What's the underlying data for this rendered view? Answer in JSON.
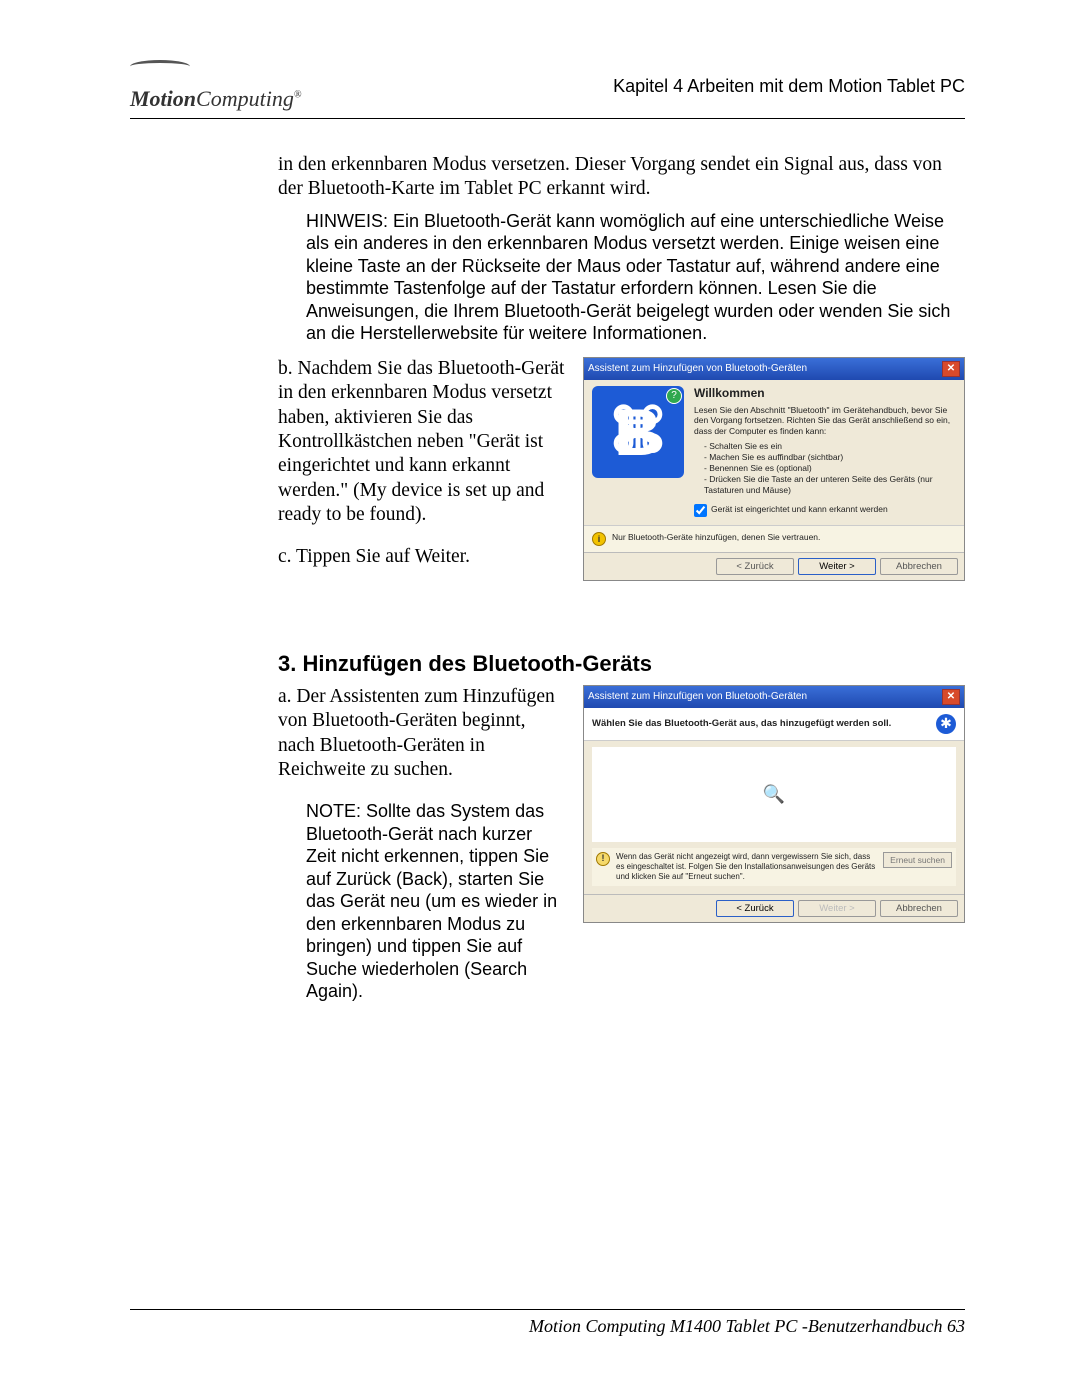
{
  "header": {
    "logo_bold": "Motion",
    "logo_light": "Computing",
    "chapter_strong": "Kapitel 4",
    "chapter_rest": " Arbeiten mit dem Motion Tablet PC"
  },
  "intro_para": "in den erkennbaren Modus versetzen. Dieser Vorgang sendet ein Signal aus, dass von der Bluetooth-Karte im Tablet PC erkannt wird.",
  "hinweis_label": "HINWEIS:",
  "hinweis_text": " Ein Bluetooth-Gerät kann womöglich auf eine unterschiedliche Weise als ein anderes in den erkennbaren Modus versetzt werden. Einige weisen eine kleine Taste an der Rückseite der Maus oder Tastatur auf, während andere eine bestimmte Tastenfolge auf der Tastatur erfordern können. Lesen Sie die Anweisungen, die Ihrem Bluetooth-Gerät beigelegt wurden oder wenden Sie sich an die Herstellerwebsite für weitere Informationen.",
  "step_b": "b. Nachdem Sie das Bluetooth-Gerät in den erkennbaren Modus versetzt haben, aktivieren Sie das Kontrollkästchen neben \"Gerät ist eingerichtet und kann erkannt werden.\" (My device is set up and ready to be found).",
  "step_c": "c. Tippen Sie auf Weiter.",
  "win1": {
    "title": "Assistent zum Hinzufügen von Bluetooth-Geräten",
    "welcome": "Willkommen",
    "desc": "Lesen Sie den Abschnitt \"Bluetooth\" im Gerätehandbuch, bevor Sie den Vorgang fortsetzen. Richten Sie das Gerät anschließend so ein, dass der Computer es finden kann:",
    "list": [
      "- Schalten Sie es ein",
      "- Machen Sie es auffindbar (sichtbar)",
      "- Benennen Sie es (optional)",
      "- Drücken Sie die Taste an der unteren Seite des Geräts (nur Tastaturen und Mäuse)"
    ],
    "checkbox": "Gerät ist eingerichtet und kann erkannt werden",
    "info": "Nur Bluetooth-Geräte hinzufügen, denen Sie vertrauen.",
    "btn_back": "< Zurück",
    "btn_next": "Weiter >",
    "btn_cancel": "Abbrechen"
  },
  "section3_heading": "3. Hinzufügen des Bluetooth-Geräts",
  "step_a": "a. Der Assistenten zum Hinzufügen von Bluetooth-Geräten beginnt, nach Bluetooth-Geräten in Reichweite zu suchen.",
  "note_label": "NOTE:",
  "note_text": " Sollte das System das Bluetooth-Gerät nach kurzer Zeit nicht erkennen, tippen Sie auf Zurück (Back), starten Sie das Gerät neu (um es wieder in den erkennbaren Modus zu bringen) und tippen Sie auf Suche wiederholen (Search Again).",
  "win2": {
    "title": "Assistent zum Hinzufügen von Bluetooth-Geräten",
    "head_text": "Wählen Sie das Bluetooth-Gerät aus, das hinzugefügt werden soll.",
    "warn": "Wenn das Gerät nicht angezeigt wird, dann vergewissern Sie sich, dass es eingeschaltet ist. Folgen Sie den Installationsanweisungen des Geräts und klicken Sie auf \"Erneut suchen\".",
    "btn_search": "Erneut suchen",
    "btn_back": "< Zurück",
    "btn_next": "Weiter >",
    "btn_cancel": "Abbrechen"
  },
  "footer_text": "Motion Computing M1400 Tablet PC -Benutzerhandbuch 63"
}
